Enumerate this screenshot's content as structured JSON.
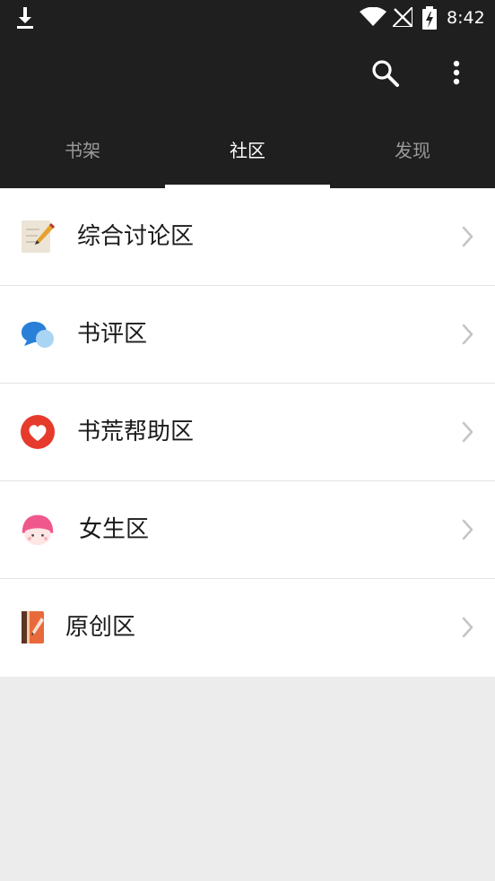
{
  "status_bar": {
    "time": "8:42",
    "icons": [
      "download-icon",
      "wifi-icon",
      "signal-off-icon",
      "battery-charging-icon"
    ]
  },
  "toolbar": {
    "icons": [
      "search-icon",
      "more-vert-icon"
    ]
  },
  "tabs": [
    {
      "label": "书架",
      "active": false
    },
    {
      "label": "社区",
      "active": true
    },
    {
      "label": "发现",
      "active": false
    }
  ],
  "community_list": [
    {
      "label": "综合讨论区",
      "icon": "notepad-pencil-icon"
    },
    {
      "label": "书评区",
      "icon": "chat-bubbles-icon"
    },
    {
      "label": "书荒帮助区",
      "icon": "heart-icon"
    },
    {
      "label": "女生区",
      "icon": "girl-face-icon"
    },
    {
      "label": "原创区",
      "icon": "book-pen-icon"
    }
  ],
  "colors": {
    "header_bg": "#1f1f1f",
    "tab_inactive": "#9a9a9a",
    "tab_active": "#ffffff",
    "page_bg": "#ececec",
    "heart_red": "#e53a2c",
    "bubble_blue": "#2a7fd8",
    "girl_pink": "#f0588d"
  }
}
